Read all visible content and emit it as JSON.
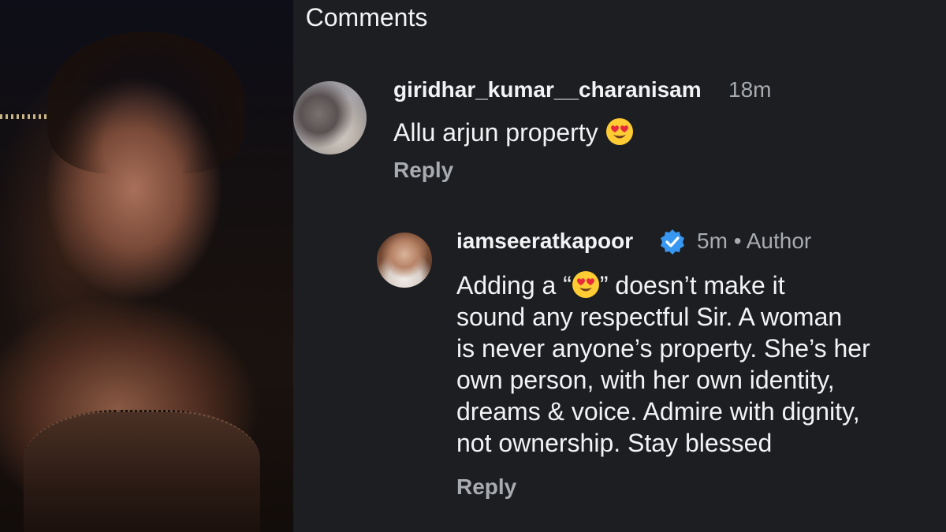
{
  "panel": {
    "title": "Comments"
  },
  "comments": [
    {
      "username": "giridhar_kumar__charanisam",
      "time": "18m",
      "text_before_emoji": "Allu arjun property ",
      "emoji_icon": "heart-eyes-emoji",
      "reply_label": "Reply"
    },
    {
      "username": "iamseeratkapoor",
      "verified_icon": "verified-badge-icon",
      "time": "5m",
      "separator": "•",
      "author_label": "Author",
      "text_line1_before": "Adding a “",
      "text_line1_emoji": "heart-eyes-emoji",
      "text_line1_after": "” doesn’t make it",
      "text_lines": [
        "sound any respectful Sir. A woman",
        "is never anyone’s property. She’s her",
        "own person, with her own identity,",
        "dreams & voice. Admire with dignity,",
        "not ownership. Stay blessed"
      ],
      "reply_label": "Reply"
    }
  ],
  "colors": {
    "background": "#1c1e21",
    "text": "#f2f3f5",
    "secondary_text": "#a8abb0",
    "verified_blue": "#3897f0",
    "emoji_yellow": "#ffcc33",
    "heart_red": "#e8283c"
  }
}
